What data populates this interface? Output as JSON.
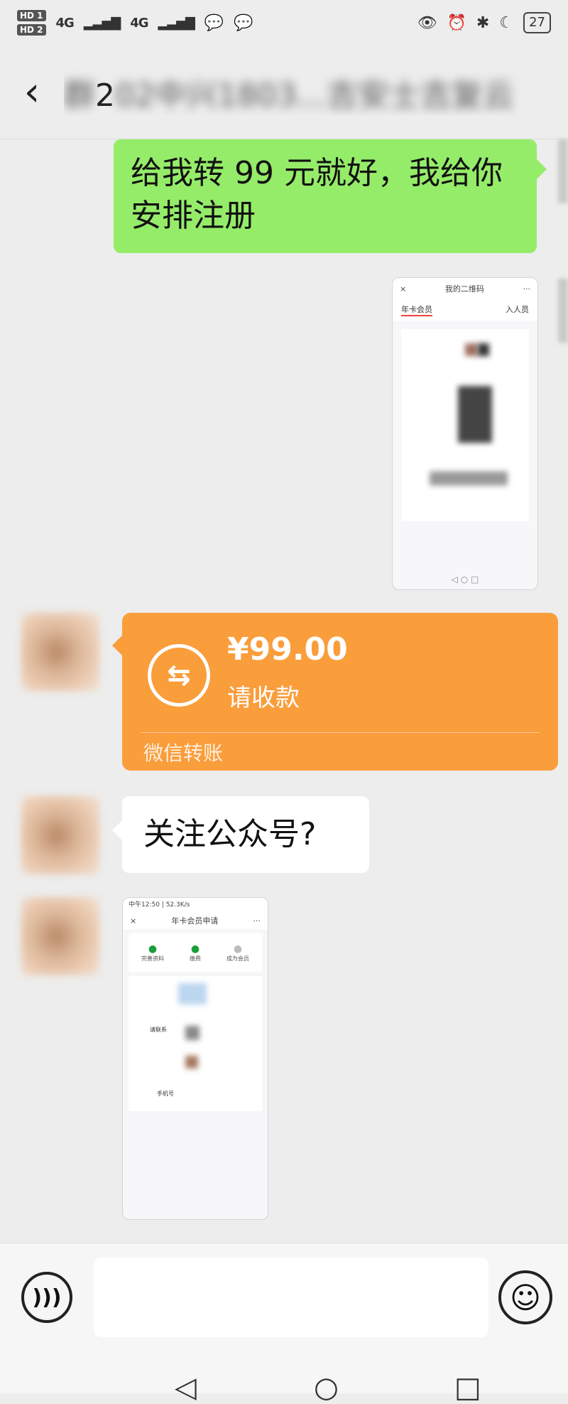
{
  "status_bar": {
    "sim1": "HD 1",
    "sim2": "HD 2",
    "network1": "4G",
    "network2": "4G",
    "battery": "27"
  },
  "header": {
    "back_icon": "chevron-left-icon",
    "title_visible": "2",
    "title_blurred": "02中兴1803...吉安士吉复云"
  },
  "messages": {
    "sent_text": "给我转 99 元就好，我给你安排注册",
    "screenshot1": {
      "title": "我的二维码",
      "tab_left": "年卡会员",
      "tab_right": "入人员",
      "close": "×",
      "more": "···"
    },
    "transfer": {
      "amount": "¥99.00",
      "note": "请收款",
      "footer": "微信转账",
      "icon": "transfer-arrows-icon"
    },
    "received_text": "关注公众号?",
    "screenshot2": {
      "status": "中午12:50 | 52.3K/s",
      "title": "年卡会员申请",
      "close": "×",
      "more": "···",
      "step1": "完善资料",
      "step2": "缴费",
      "step3": "成为会员",
      "field1": "请联系",
      "field2": "手机号"
    }
  },
  "input_bar": {
    "voice_icon": "voice-icon",
    "emoji_icon": "emoji-icon",
    "text_value": ""
  },
  "nav": {
    "back": "◁",
    "home": "○",
    "recent": "□"
  }
}
